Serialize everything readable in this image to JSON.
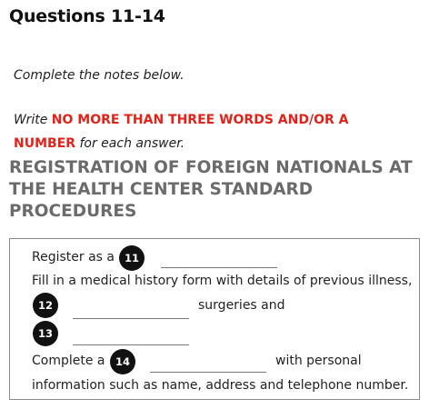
{
  "heading": "Questions 11-14",
  "instructions": {
    "line1": "Complete the notes below.",
    "write_prefix": "Write ",
    "emphasis_a": "NO MORE THAN THREE WORDS AND/OR A",
    "emphasis_b": "NUMBER",
    "write_suffix": " for each answer."
  },
  "section_title": "REGISTRATION OF FOREIGN NATIONALS AT THE HEALTH CENTER STANDARD PROCEDURES",
  "notes": {
    "register_prefix": "Register as a",
    "fill_in": "Fill in a medical history form with details of previous illness,",
    "surgeries_and": "surgeries and",
    "complete_prefix": "Complete a",
    "with_personal": "with personal",
    "info_line": "information such as name, address and telephone number."
  },
  "questions": {
    "q11": "11",
    "q12": "12",
    "q13": "13",
    "q14": "14"
  },
  "colors": {
    "emphasis_red": "#e2231a",
    "section_gray": "#6b6b6b",
    "badge_black": "#111111"
  }
}
